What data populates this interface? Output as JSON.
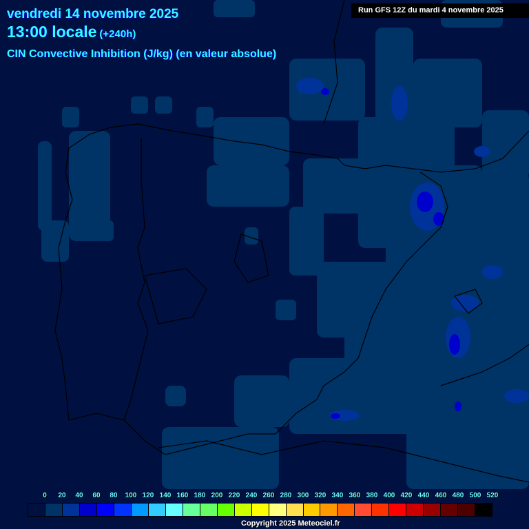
{
  "header": {
    "date": "vendredi 14 novembre 2025",
    "time": "13:00 locale",
    "lead": "(+240h)",
    "parameter": "CIN Convective Inhibition (J/kg) (en valeur absolue)"
  },
  "run": "Run GFS 12Z du mardi 4 novembre 2025",
  "legend": {
    "labels": [
      "0",
      "20",
      "40",
      "60",
      "80",
      "100",
      "120",
      "140",
      "160",
      "180",
      "200",
      "220",
      "240",
      "260",
      "280",
      "300",
      "320",
      "340",
      "360",
      "380",
      "400",
      "420",
      "440",
      "460",
      "480",
      "500",
      "520"
    ],
    "colors": [
      "#001040",
      "#003366",
      "#003399",
      "#0000cc",
      "#0000ff",
      "#0033ff",
      "#0099ff",
      "#33ccff",
      "#66ffff",
      "#66ff99",
      "#66ff66",
      "#66ff00",
      "#ccff00",
      "#ffff00",
      "#ffff80",
      "#ffe050",
      "#ffcc00",
      "#ff9900",
      "#ff6600",
      "#ff4c33",
      "#ff3300",
      "#ff0000",
      "#cc0000",
      "#990000",
      "#660000",
      "#4d0000",
      "#000000"
    ]
  },
  "copyright": "Copyright 2025 Meteociel.fr"
}
